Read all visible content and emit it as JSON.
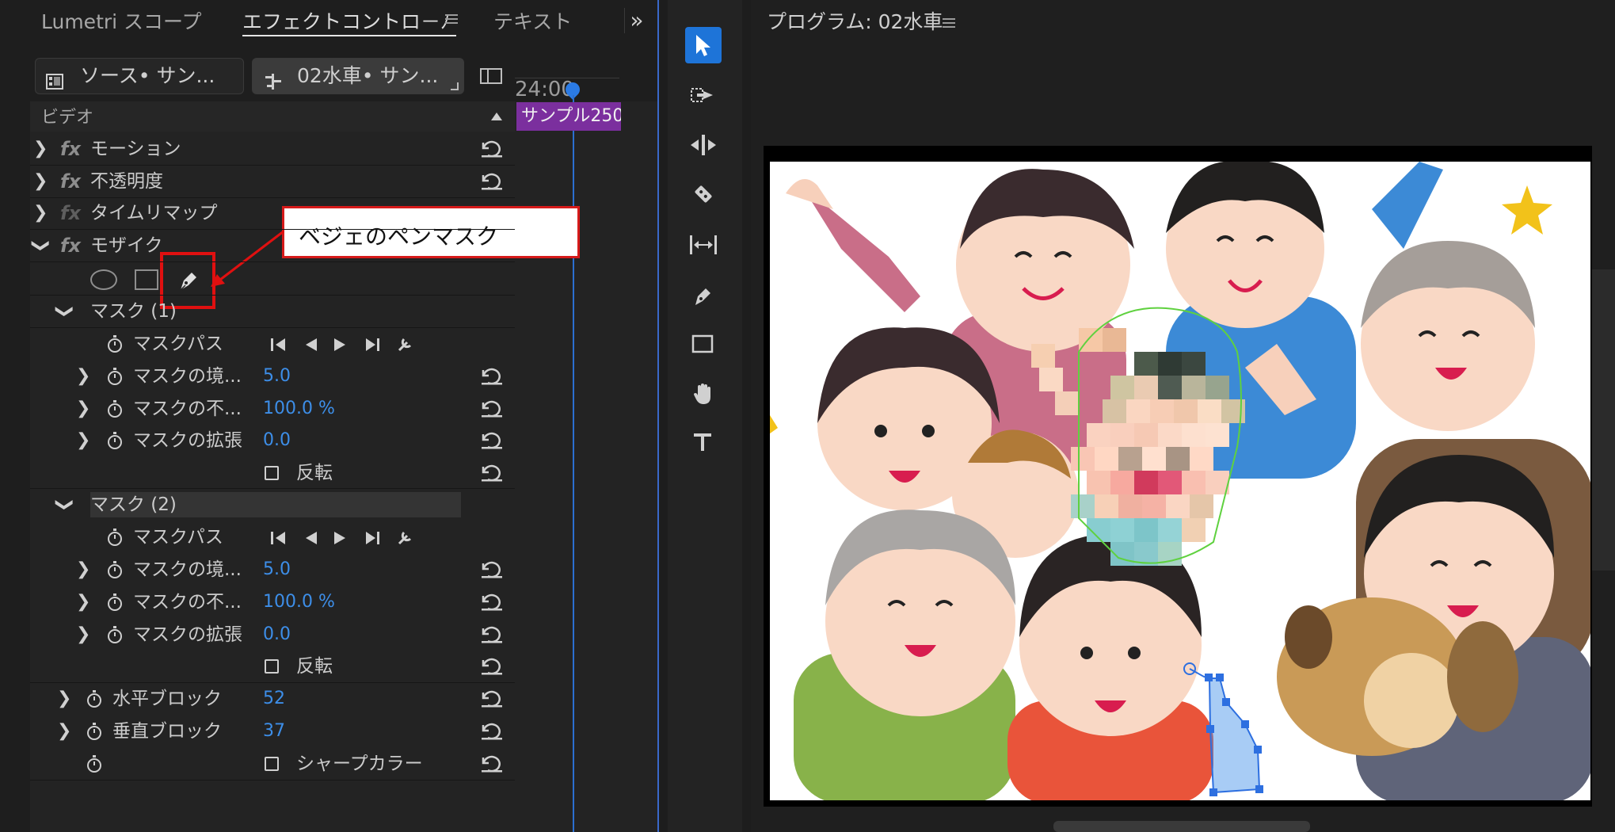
{
  "tabs": {
    "lumetri": "Lumetri スコープ",
    "effect_controls": "エフェクトコントロ－ﾉ",
    "text": "テキスト",
    "menu_icon": "hamburger-menu-icon",
    "overflow": "»"
  },
  "source": {
    "source_label": "ソース• サン...",
    "sequence_label": "02水車• サン..."
  },
  "timeline": {
    "timecode": "24:00",
    "clip_label": "サンプル250"
  },
  "effects": {
    "section_label": "ビデオ",
    "items": {
      "motion": "モーション",
      "opacity": "不透明度",
      "time_remap": "タイムリマップ",
      "mosaic": "モザイク"
    }
  },
  "callout": {
    "text": "ベジェのペンマスク"
  },
  "mask1": {
    "title": "マスク (1)",
    "path_label": "マスクパス",
    "feather_label": "マスクの境...",
    "feather_value": "5.0",
    "opacity_label": "マスクの不...",
    "opacity_value": "100.0 %",
    "expansion_label": "マスクの拡張",
    "expansion_value": "0.0",
    "invert_label": "反転"
  },
  "mask2": {
    "title": "マスク (2)",
    "path_label": "マスクパス",
    "feather_label": "マスクの境...",
    "feather_value": "5.0",
    "opacity_label": "マスクの不...",
    "opacity_value": "100.0 %",
    "expansion_label": "マスクの拡張",
    "expansion_value": "0.0",
    "invert_label": "反転"
  },
  "mosaic_params": {
    "h_blocks_label": "水平ブロック",
    "h_blocks_value": "52",
    "v_blocks_label": "垂直ブロック",
    "v_blocks_value": "37",
    "sharp_color_label": "シャープカラー"
  },
  "program": {
    "title": "プログラム: 02水車"
  },
  "colors": {
    "accent_blue": "#3d8ee8",
    "selection_tool": "#1e74d8",
    "clip_purple": "#7b2f9e",
    "callout_red": "#e01010",
    "mask_blue": "#3d8ee8",
    "mask_green": "#5fd13f"
  }
}
